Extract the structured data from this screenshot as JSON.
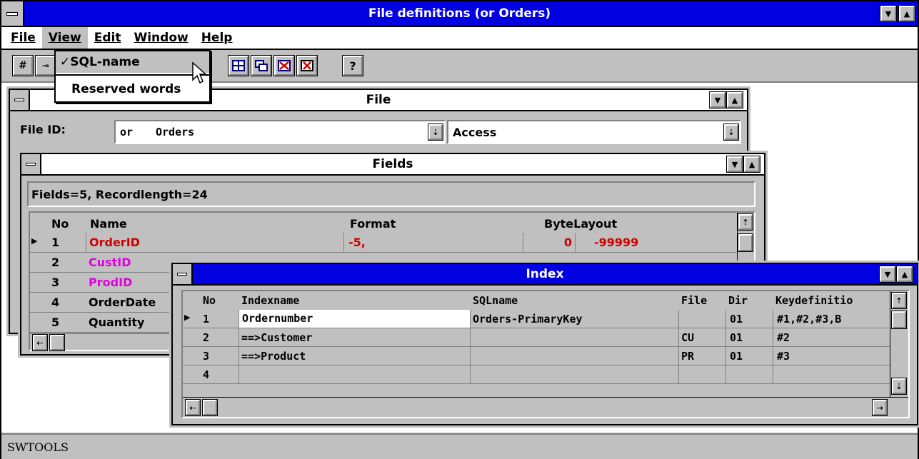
{
  "window": {
    "title": "File definitions (or Orders)"
  },
  "menubar": {
    "items": [
      "File",
      "View",
      "Edit",
      "Window",
      "Help"
    ]
  },
  "view_menu": {
    "items": [
      {
        "label": "SQL-name",
        "checked": true
      },
      {
        "label": "Reserved words",
        "checked": false
      }
    ]
  },
  "toolbar": {
    "icons": [
      "hash-icon",
      "key-icon",
      "grid-icon",
      "cascade-icon",
      "delete-field-icon",
      "close-x-icon",
      "help-icon"
    ]
  },
  "file_window": {
    "title": "File",
    "file_id_label": "File ID:",
    "file_id_code": "or",
    "file_id_name": "Orders",
    "driver": "Access"
  },
  "fields_window": {
    "title": "Fields",
    "summary": "Fields=5, Recordlength=24",
    "columns": [
      "No",
      "Name",
      "Format",
      "ByteLayout"
    ],
    "rows": [
      {
        "no": "1",
        "name": "OrderID",
        "format": "-5,",
        "offset": "0",
        "range": "-99999",
        "color": "#d00000"
      },
      {
        "no": "2",
        "name": "CustID",
        "color": "#e000e0"
      },
      {
        "no": "3",
        "name": "ProdID",
        "color": "#e000e0"
      },
      {
        "no": "4",
        "name": "OrderDate",
        "color": "#000000"
      },
      {
        "no": "5",
        "name": "Quantity",
        "color": "#000000"
      }
    ]
  },
  "index_window": {
    "title": "Index",
    "columns": [
      "No",
      "Indexname",
      "SQLname",
      "File",
      "Dir",
      "Keydefinitio"
    ],
    "rows": [
      {
        "no": "1",
        "indexname": "Ordernumber",
        "sqlname": "Orders-PrimaryKey",
        "file": "",
        "dir": "01",
        "keydef": "#1,#2,#3,B"
      },
      {
        "no": "2",
        "indexname": "==>Customer",
        "sqlname": "",
        "file": "CU",
        "dir": "01",
        "keydef": "#2"
      },
      {
        "no": "3",
        "indexname": "==>Product",
        "sqlname": "",
        "file": "PR",
        "dir": "01",
        "keydef": "#3"
      },
      {
        "no": "4",
        "indexname": "",
        "sqlname": "",
        "file": "",
        "dir": "",
        "keydef": ""
      }
    ]
  },
  "statusbar": {
    "text": "SWTOOLS"
  },
  "colors": {
    "titlebar_active": "#0000e0",
    "face": "#c0c0c0",
    "required_field": "#d00000",
    "key_field": "#e000e0"
  }
}
